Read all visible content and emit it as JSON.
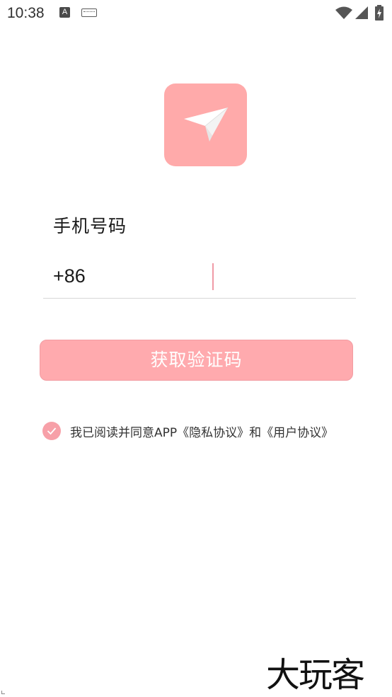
{
  "status_bar": {
    "time": "10:38",
    "notification_icon_letter": "A",
    "icons": [
      "notification-a-icon",
      "keyboard-icon",
      "wifi-icon",
      "signal-icon",
      "battery-charging-icon"
    ]
  },
  "logo": {
    "icon": "paper-plane-icon",
    "color": "#ffaaaa"
  },
  "form": {
    "phone_label": "手机号码",
    "country_code": "+86",
    "phone_value": "",
    "phone_placeholder": ""
  },
  "actions": {
    "get_code_label": "获取验证码",
    "button_color": "#ffaaae"
  },
  "agreement": {
    "checked": true,
    "text": "我已阅读并同意APP《隐私协议》和《用户协议》"
  },
  "watermark": {
    "text": "大玩客"
  }
}
